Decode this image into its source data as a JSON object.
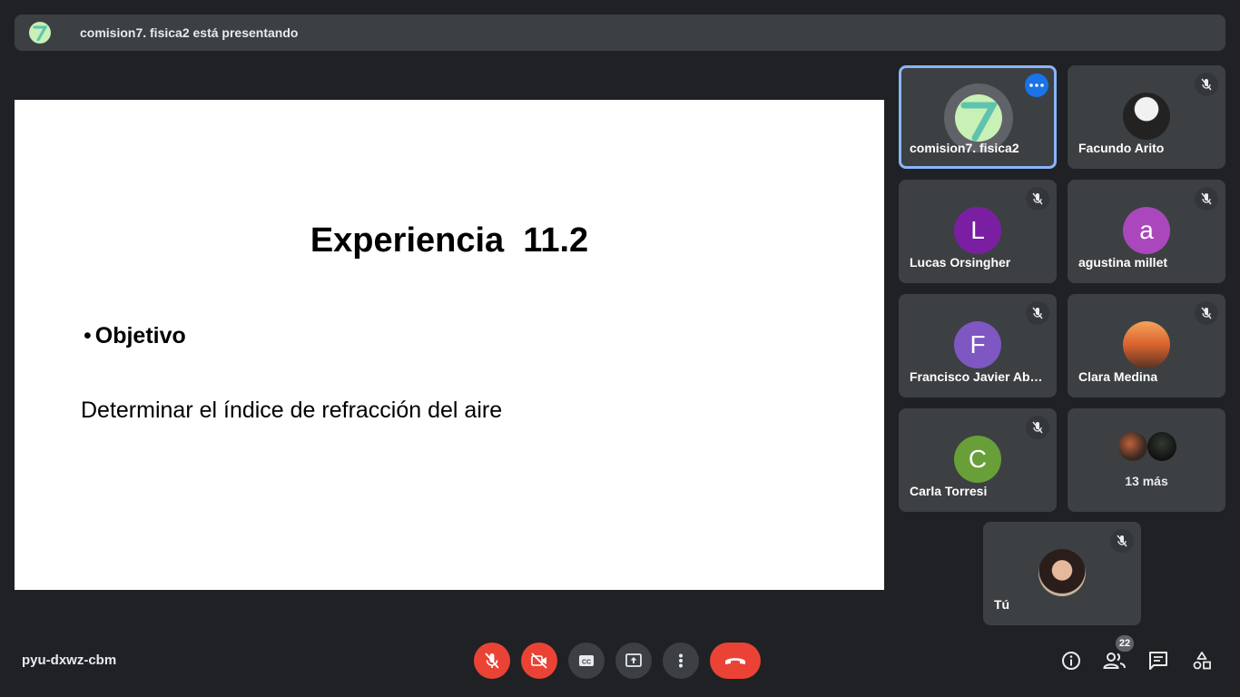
{
  "banner": {
    "text": "comision7. fisica2 está presentando",
    "avatar_icon": "seven-logo-icon"
  },
  "slide": {
    "title": "Experiencia  11.2",
    "bullet_marker": "•",
    "bullet_heading": "Objetivo",
    "body": "Determinar el índice de refracción del aire"
  },
  "participants": [
    {
      "name": "comision7. fisica2",
      "avatar": "logo",
      "active": true
    },
    {
      "name": "Facundo Arito",
      "avatar": "photo",
      "muted": true
    },
    {
      "name": "Lucas Orsingher",
      "initial": "L",
      "color": "#7b1fa2",
      "muted": true
    },
    {
      "name": "agustina millet",
      "initial": "a",
      "color": "#ab47bc",
      "muted": true
    },
    {
      "name": "Francisco Javier Abr…",
      "initial": "F",
      "color": "#7e57c2",
      "muted": true
    },
    {
      "name": "Clara Medina",
      "avatar": "photo",
      "muted": true
    },
    {
      "name": "Carla Torresi",
      "initial": "C",
      "color": "#689f38",
      "muted": true
    },
    {
      "more_label": "13 más"
    },
    {
      "name": "Tú",
      "avatar": "photo",
      "muted": true
    }
  ],
  "footer": {
    "meeting_code": "pyu-dxwz-cbm",
    "people_count": "22",
    "colors": {
      "danger": "#ea4335",
      "control": "#3c4043",
      "accent": "#1a73e8"
    }
  }
}
